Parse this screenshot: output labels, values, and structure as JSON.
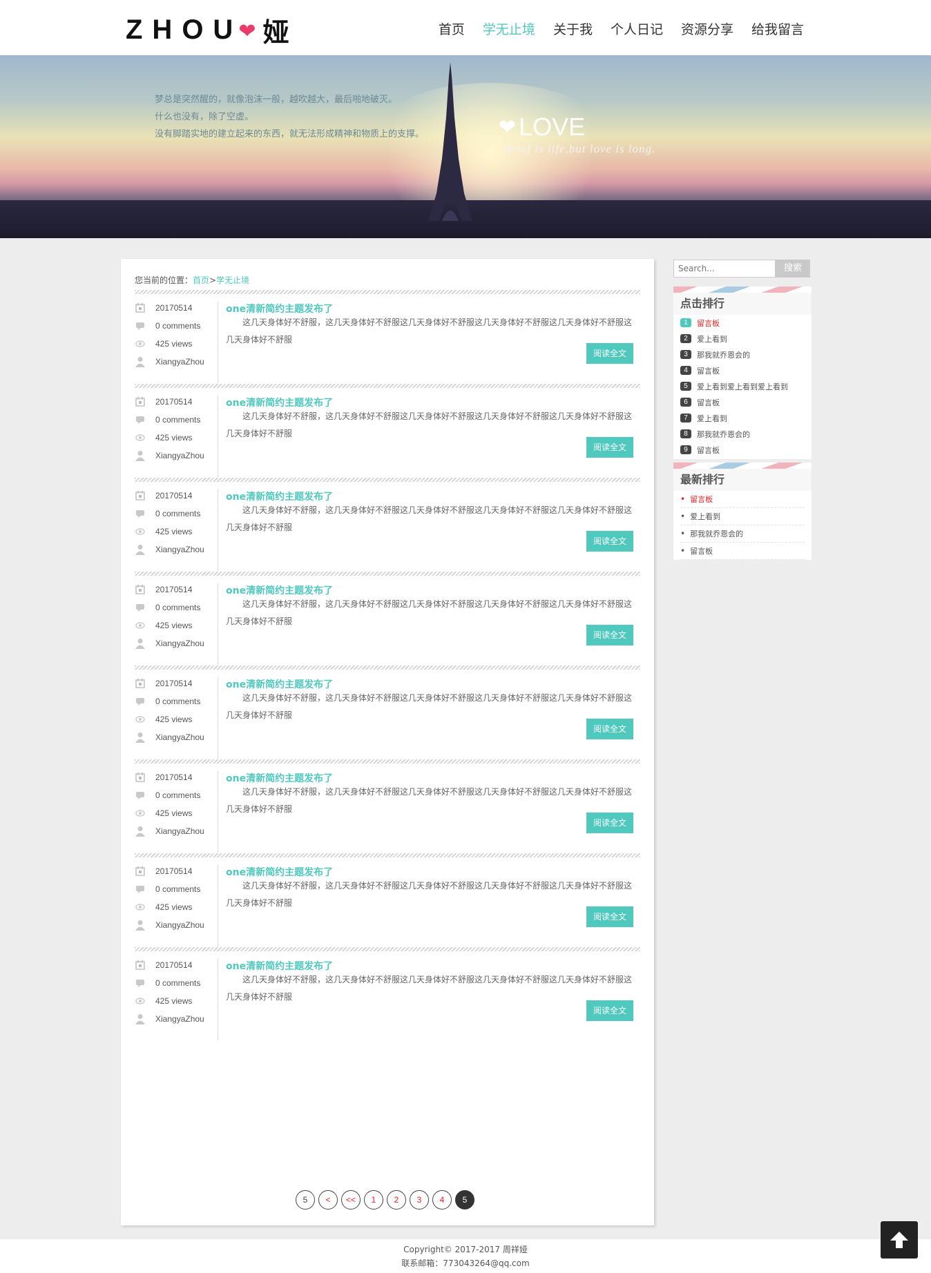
{
  "header": {
    "logo_text": "ZHOU",
    "logo_char": "娅",
    "nav": [
      "首页",
      "学无止境",
      "关于我",
      "个人日记",
      "资源分享",
      "给我留言"
    ],
    "active_nav": "学无止境"
  },
  "banner": {
    "quote": [
      "梦总是突然醒的，就像泡沫一般，越吹越大，最后啪地破灭。",
      "什么也没有，除了空虚。",
      "没有脚踏实地的建立起来的东西，就无法形成精神和物质上的支撑。"
    ],
    "love_title": "LOVE",
    "love_subtitle": "Brief is life,but love is long."
  },
  "breadcrumb": {
    "label": "您当前的位置：",
    "home": "首页",
    "separator": ">",
    "current": "学无止境"
  },
  "posts": [
    {
      "date": "20170514",
      "comments": "0 comments",
      "views": "425 views",
      "author": "XiangyaZhou",
      "title": "one清新简约主题发布了",
      "excerpt": "这几天身体好不舒服，这几天身体好不舒服这几天身体好不舒服这几天身体好不舒服这几天身体好不舒服这几天身体好不舒服",
      "button": "阅读全文"
    },
    {
      "date": "20170514",
      "comments": "0 comments",
      "views": "425 views",
      "author": "XiangyaZhou",
      "title": "one清新简约主题发布了",
      "excerpt": "这几天身体好不舒服，这几天身体好不舒服这几天身体好不舒服这几天身体好不舒服这几天身体好不舒服这几天身体好不舒服",
      "button": "阅读全文"
    },
    {
      "date": "20170514",
      "comments": "0 comments",
      "views": "425 views",
      "author": "XiangyaZhou",
      "title": "one清新简约主题发布了",
      "excerpt": "这几天身体好不舒服，这几天身体好不舒服这几天身体好不舒服这几天身体好不舒服这几天身体好不舒服这几天身体好不舒服",
      "button": "阅读全文"
    },
    {
      "date": "20170514",
      "comments": "0 comments",
      "views": "425 views",
      "author": "XiangyaZhou",
      "title": "one清新简约主题发布了",
      "excerpt": "这几天身体好不舒服，这几天身体好不舒服这几天身体好不舒服这几天身体好不舒服这几天身体好不舒服这几天身体好不舒服",
      "button": "阅读全文"
    },
    {
      "date": "20170514",
      "comments": "0 comments",
      "views": "425 views",
      "author": "XiangyaZhou",
      "title": "one清新简约主题发布了",
      "excerpt": "这几天身体好不舒服，这几天身体好不舒服这几天身体好不舒服这几天身体好不舒服这几天身体好不舒服这几天身体好不舒服",
      "button": "阅读全文"
    },
    {
      "date": "20170514",
      "comments": "0 comments",
      "views": "425 views",
      "author": "XiangyaZhou",
      "title": "one清新简约主题发布了",
      "excerpt": "这几天身体好不舒服，这几天身体好不舒服这几天身体好不舒服这几天身体好不舒服这几天身体好不舒服这几天身体好不舒服",
      "button": "阅读全文"
    },
    {
      "date": "20170514",
      "comments": "0 comments",
      "views": "425 views",
      "author": "XiangyaZhou",
      "title": "one清新简约主题发布了",
      "excerpt": "这几天身体好不舒服，这几天身体好不舒服这几天身体好不舒服这几天身体好不舒服这几天身体好不舒服这几天身体好不舒服",
      "button": "阅读全文"
    },
    {
      "date": "20170514",
      "comments": "0 comments",
      "views": "425 views",
      "author": "XiangyaZhou",
      "title": "one清新简约主题发布了",
      "excerpt": "这几天身体好不舒服，这几天身体好不舒服这几天身体好不舒服这几天身体好不舒服这几天身体好不舒服这几天身体好不舒服",
      "button": "阅读全文"
    }
  ],
  "pagination": {
    "items": [
      "5",
      "<",
      "<<",
      "1",
      "2",
      "3",
      "4",
      "5"
    ],
    "current": "5"
  },
  "sidebar": {
    "search_placeholder": "Search...",
    "search_button": "搜索",
    "click_rank_title": "点击排行",
    "click_rank": [
      {
        "num": "1",
        "label": "留言板"
      },
      {
        "num": "2",
        "label": "爱上看到"
      },
      {
        "num": "3",
        "label": "那我就乔恩会的"
      },
      {
        "num": "4",
        "label": "留言板"
      },
      {
        "num": "5",
        "label": "爱上看到爱上看到爱上看到"
      },
      {
        "num": "6",
        "label": "留言板"
      },
      {
        "num": "7",
        "label": "爱上看到"
      },
      {
        "num": "8",
        "label": "那我就乔恩会的"
      },
      {
        "num": "9",
        "label": "留言板"
      }
    ],
    "latest_title": "最新排行",
    "latest": [
      "留言板",
      "爱上看到",
      "那我就乔恩会的",
      "留言板"
    ]
  },
  "footer": {
    "copyright": "Copyright© 2017-2017 周祥娅",
    "email": "联系邮箱：773043264@qq.com"
  },
  "colors": {
    "accent": "#4fc9be",
    "highlight": "#e22222",
    "logo_heart": "#ea3b6b"
  },
  "icons": {
    "meta": [
      "calendar-icon",
      "comment-icon",
      "eye-icon",
      "user-icon"
    ],
    "back_to_top": "arrow-up-icon"
  }
}
